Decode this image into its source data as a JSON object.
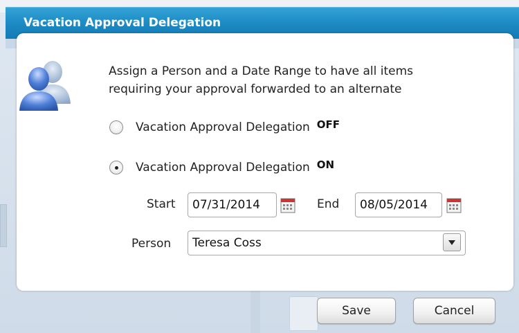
{
  "dialog": {
    "title": "Vacation Approval Delegation",
    "intro_line1": "Assign a Person and a Date Range to have all items",
    "intro_line2": "requiring your approval forwarded to an alternate"
  },
  "options": [
    {
      "label": "Vacation Approval Delegation",
      "state": "OFF",
      "selected": false
    },
    {
      "label": "Vacation Approval Delegation",
      "state": "ON",
      "selected": true
    }
  ],
  "dates": {
    "start_label": "Start",
    "start_value": "07/31/2014",
    "end_label": "End",
    "end_value": "08/05/2014"
  },
  "person": {
    "label": "Person",
    "value": "Teresa Coss"
  },
  "buttons": {
    "save": "Save",
    "cancel": "Cancel"
  },
  "icons": {
    "people": "people-icon",
    "calendar": "calendar-icon",
    "dropdown": "chevron-down-icon"
  },
  "colors": {
    "titlebar": "#1b88c2",
    "title_text": "#ffffff"
  }
}
